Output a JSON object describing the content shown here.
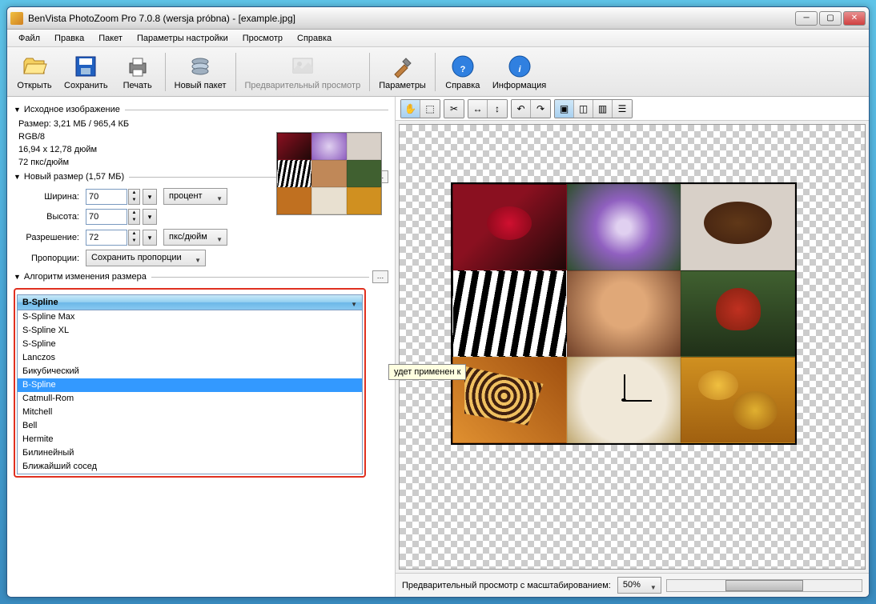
{
  "title": "BenVista PhotoZoom Pro 7.0.8 (wersja próbna) - [example.jpg]",
  "menu": {
    "file": "Файл",
    "edit": "Правка",
    "batch": "Пакет",
    "settings": "Параметры настройки",
    "view": "Просмотр",
    "help": "Справка"
  },
  "toolbar": {
    "open": "Открыть",
    "save": "Сохранить",
    "print": "Печать",
    "newbatch": "Новый пакет",
    "preview": "Предварительный просмотр",
    "params": "Параметры",
    "helpb": "Справка",
    "info": "Информация"
  },
  "src": {
    "header": "Исходное изображение",
    "size": "Размер: 3,21 МБ / 965,4 КБ",
    "mode": "RGB/8",
    "dim": "16,94 x 12,78 дюйм",
    "dpi": "72 пкс/дюйм"
  },
  "newsize": {
    "header": "Новый размер (1,57 МБ)",
    "width_l": "Ширина:",
    "width": "70",
    "height_l": "Высота:",
    "height": "70",
    "res_l": "Разрешение:",
    "res": "72",
    "unit": "процент",
    "resunit": "пкс/дюйм",
    "prop_l": "Пропорции:",
    "prop": "Сохранить пропорции"
  },
  "algo": {
    "header": "Алгоритм изменения размера",
    "selected": "B-Spline",
    "items": [
      "S-Spline Max",
      "S-Spline XL",
      "S-Spline",
      "Lanczos",
      "Бикубический",
      "B-Spline",
      "Catmull-Rom",
      "Mitchell",
      "Bell",
      "Hermite",
      "Билинейный",
      "Ближайший сосед"
    ]
  },
  "tooltip": "удет применен к",
  "bottom": {
    "label": "Предварительный просмотр с масштабированием:",
    "zoom": "50%"
  }
}
